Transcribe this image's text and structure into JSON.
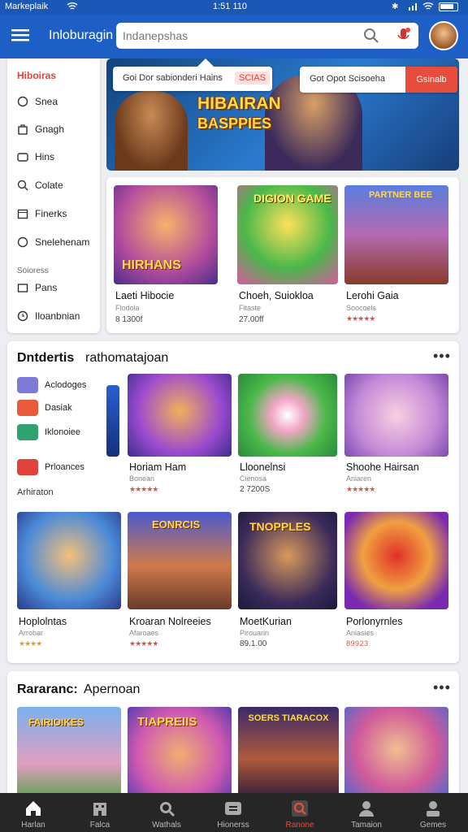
{
  "status_bar": {
    "carrier": "Markeplaik",
    "time": "1:51 110"
  },
  "app_bar": {
    "title": "Inloburagin",
    "search_placeholder": "Indanepshas"
  },
  "sidebar": {
    "heading": "Hiboiras",
    "items": [
      {
        "label": "Snea",
        "icon": "shield-icon"
      },
      {
        "label": "Gnagh",
        "icon": "bag-icon"
      },
      {
        "label": "Hins",
        "icon": "gamepad-icon"
      },
      {
        "label": "Colate",
        "icon": "search-icon"
      },
      {
        "label": "Finerks",
        "icon": "calendar-icon"
      },
      {
        "label": "Snelehenam",
        "icon": "globe-icon"
      }
    ],
    "group_label": "Soioress",
    "group_items": [
      {
        "label": "Pans",
        "icon": "square-icon"
      },
      {
        "label": "Iloanbnian",
        "icon": "clock-icon"
      }
    ]
  },
  "banner": {
    "title_line1": "HIBAIRAN",
    "title_line2": "BASPPIES",
    "search1_text": "Goi Dor sabionderi Hains",
    "search1_tag": "SCIAS",
    "search2_text": "Got Opot Scisoeha",
    "search2_button": "Gsinalb"
  },
  "featured": [
    {
      "title": "Laeti Hibocie",
      "sub": "Flodola",
      "meta": "8 1300f",
      "thumb_text": "HIRHANS"
    },
    {
      "title": "Choeh, Suiokloa",
      "sub": "Fitaste",
      "meta": "27.00ff",
      "thumb_text": "DIGION GAME"
    },
    {
      "title": "Lerohi Gaia",
      "sub": "Soocoels",
      "meta": "★★★★★",
      "thumb_text": "PARTNER BEE"
    }
  ],
  "section1": {
    "title": "Dntdertis",
    "subtitle": "rathomatajoan",
    "categories": [
      {
        "label": "Aclodoges",
        "color": "#7d7ad8"
      },
      {
        "label": "Dasiak",
        "color": "#e85a3a"
      },
      {
        "label": "Iklonoiee",
        "color": "#2ea36f"
      },
      {
        "label": "Prloances",
        "color": "#e0433a"
      }
    ],
    "footer_label": "Arhiraton",
    "row1": [
      {
        "title": "Horiam Ham",
        "sub": "Bonean",
        "meta": "★★★★★"
      },
      {
        "title": "Lloonelnsi",
        "sub": "Cienosa",
        "meta": "2 7200S"
      },
      {
        "title": "Shoohe Hairsan",
        "sub": "Aniaren",
        "meta": "★★★★★"
      }
    ],
    "row2": [
      {
        "title": "Hoplolntas",
        "sub": "Arrobar",
        "meta": "★★★★",
        "thumb_text": ""
      },
      {
        "title": "Kroaran Nolreeies",
        "sub": "Afaroaes",
        "meta": "★★★★★",
        "thumb_text": "EONRCIS"
      },
      {
        "title": "MoetKurian",
        "sub": "Pirouarin",
        "meta": "89.1.00",
        "thumb_text": "TNOPPLES"
      },
      {
        "title": "Porlonyrnles",
        "sub": "Aniasies",
        "meta": "8 9 9 2 3",
        "thumb_text": ""
      }
    ]
  },
  "section2": {
    "title": "Rararanc:",
    "subtitle": "Apernoan",
    "thumbs": [
      "FAIRIOIKES",
      "TIAPREIIS",
      "SOERS TIARACOX",
      ""
    ]
  },
  "bottom_nav": [
    {
      "label": "Harlan",
      "icon": "home-icon"
    },
    {
      "label": "Falca",
      "icon": "building-icon"
    },
    {
      "label": "Wathals",
      "icon": "search-icon"
    },
    {
      "label": "Hionerss",
      "icon": "tv-icon"
    },
    {
      "label": "Ranone",
      "icon": "magnifier-red-icon",
      "active": true
    },
    {
      "label": "Tamaion",
      "icon": "person-icon"
    },
    {
      "label": "Gemes",
      "icon": "profile-card-icon"
    }
  ],
  "colors": {
    "primary": "#1d5fc4",
    "accent": "#e74c3c",
    "nav_bg": "#262626",
    "star": "#d9533f"
  }
}
